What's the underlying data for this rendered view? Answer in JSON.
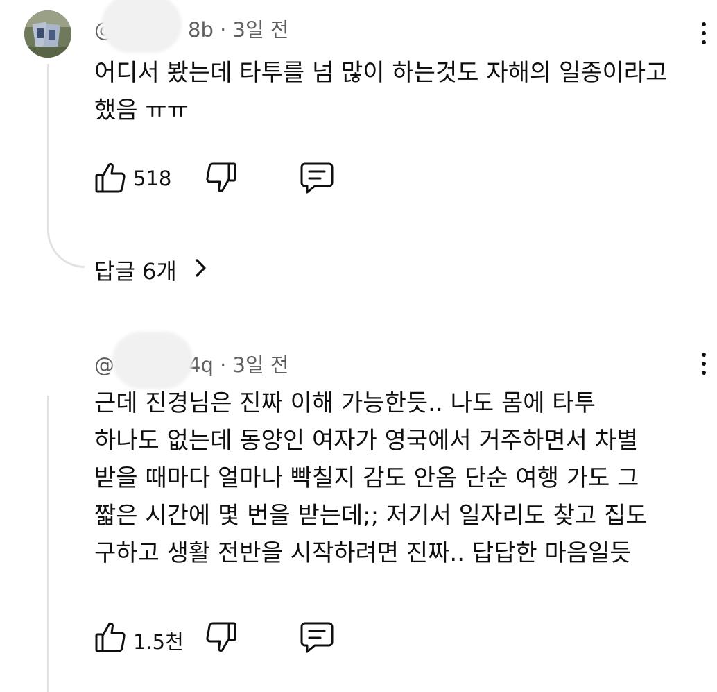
{
  "comments": [
    {
      "author": "@",
      "author_suffix": "8b",
      "separator": "·",
      "time": "3일 전",
      "text_lines": [
        "어디서 봤는데 타투를 넘 많이 하는것도 자해의 일종이라고",
        "했음 ㅠㅠ"
      ],
      "likes": "518",
      "replies_label": "답글 6개"
    },
    {
      "author": "@",
      "author_suffix": "4q",
      "separator": "·",
      "time": "3일 전",
      "text_lines": [
        "근데 진경님은 진짜 이해 가능한듯.. 나도 몸에 타투",
        "하나도 없는데 동양인 여자가 영국에서 거주하면서 차별",
        "받을 때마다 얼마나 빡칠지 감도 안옴 단순 여행 가도 그",
        "짧은 시간에 몇 번을 받는데;; 저기서 일자리도 찾고 집도",
        "구하고 생활 전반을 시작하려면 진짜.. 답답한 마음일듯"
      ],
      "likes": "1.5천"
    }
  ],
  "icons": {
    "like": "thumbs-up-icon",
    "dislike": "thumbs-down-icon",
    "reply": "comment-icon",
    "menu": "more-vertical-icon",
    "replies_chevron": "chevron-right-icon"
  },
  "colors": {
    "text": "#0f0f0f",
    "meta": "#606060",
    "thread_line": "#e2e2e2",
    "background": "#ffffff"
  }
}
